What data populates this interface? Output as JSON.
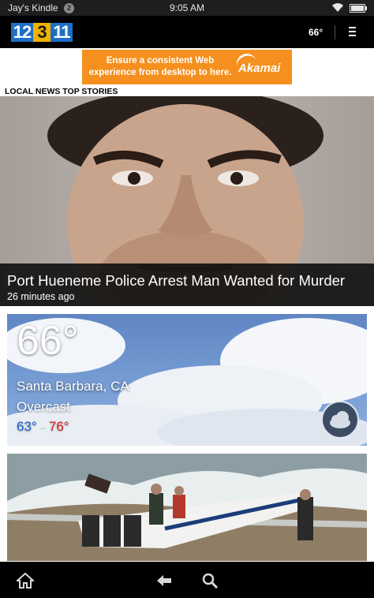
{
  "status_bar": {
    "device_name": "Jay's Kindle",
    "notification_count": "2",
    "time": "9:05 AM",
    "battery_level": 1.0
  },
  "header": {
    "logo": {
      "part1": "12",
      "part2": "3",
      "part3": "11"
    },
    "temperature": "66°",
    "menu_icon": "hamburger-menu-icon"
  },
  "ad": {
    "text": "Ensure a consistent Web experience from desktop to here.",
    "brand": "Akamai"
  },
  "section": {
    "title": "LOCAL NEWS TOP STORIES"
  },
  "top_story": {
    "headline": "Port Hueneme Police Arrest Man Wanted for Murder",
    "time_ago": "26 minutes ago"
  },
  "weather": {
    "temperature": "66°",
    "location": "Santa Barbara, CA",
    "condition": "Overcast",
    "low": "63°",
    "separator": "-",
    "high": "76°",
    "icon": "cloud-icon"
  },
  "bottom_nav": {
    "items": [
      "home-icon",
      "back-arrow-icon",
      "search-icon"
    ]
  },
  "colors": {
    "status_bar_bg": "#1e1e1e",
    "header_bg": "#000000",
    "ad_bg": "#f5901e",
    "weather_low": "#1a5fd1",
    "weather_high": "#e01f1f"
  }
}
